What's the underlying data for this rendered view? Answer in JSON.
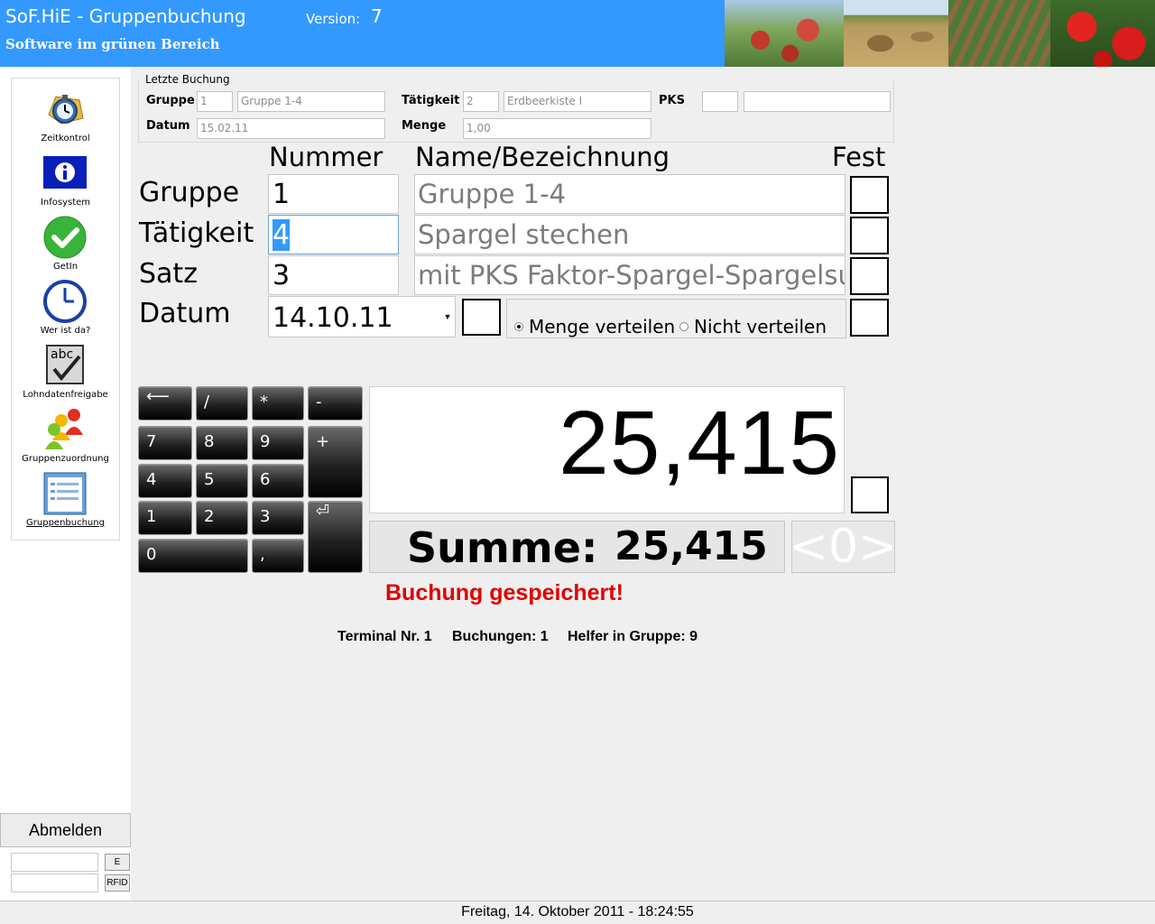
{
  "header": {
    "title": "SoF.HiE - Gruppenbuchung",
    "version_label": "Version:",
    "version_value": "7",
    "subtitle": "Software im grünen Bereich"
  },
  "sidebar": {
    "items": [
      {
        "label": "Zeitkontrol",
        "icon": "stopwatch-icon"
      },
      {
        "label": "Infosystem",
        "icon": "info-icon"
      },
      {
        "label": "GetIn",
        "icon": "checkmark-icon"
      },
      {
        "label": "Wer ist da?",
        "icon": "clock-icon"
      },
      {
        "label": "Lohndatenfreigabe",
        "icon": "abc-check-icon"
      },
      {
        "label": "Gruppenzuordnung",
        "icon": "people-group-icon"
      },
      {
        "label": "Gruppenbuchung",
        "icon": "list-window-icon",
        "active": true
      }
    ]
  },
  "login": {
    "logout_label": "Abmelden",
    "e_button": "E",
    "rfid_button": "RFID"
  },
  "last_booking": {
    "legend": "Letzte Buchung",
    "gruppe_label": "Gruppe",
    "gruppe_nr": "1",
    "gruppe_name": "Gruppe 1-4",
    "taetigkeit_label": "Tätigkeit",
    "taetigkeit_nr": "2",
    "taetigkeit_name": "Erdbeerkiste I",
    "pks_label": "PKS",
    "pks_nr": "",
    "pks_name": "",
    "datum_label": "Datum",
    "datum_value": "15.02.11",
    "menge_label": "Menge",
    "menge_value": "1,00"
  },
  "form": {
    "col_nummer": "Nummer",
    "col_name": "Name/Bezeichnung",
    "col_fest": "Fest",
    "rows": [
      {
        "label": "Gruppe",
        "nummer": "1",
        "name": "Gruppe 1-4"
      },
      {
        "label": "Tätigkeit",
        "nummer": "4",
        "name": "Spargel stechen"
      },
      {
        "label": "Satz",
        "nummer": "3",
        "name": "mit PKS Faktor-Spargel-Spargelsuppe"
      }
    ],
    "datum_label": "Datum",
    "datum_value": "14.10.11",
    "radio_menge": "Menge verteilen",
    "radio_nicht": "Nicht verteilen",
    "radio_selected": "Menge verteilen"
  },
  "keypad": {
    "backspace": "⟵",
    "divide": "/",
    "multiply": "*",
    "minus": "-",
    "plus": "+",
    "enter": "⏎",
    "k7": "7",
    "k8": "8",
    "k9": "9",
    "k4": "4",
    "k5": "5",
    "k6": "6",
    "k1": "1",
    "k2": "2",
    "k3": "3",
    "k0": "0",
    "comma": ","
  },
  "display": {
    "value": "25,415",
    "sum_label": "Summe:",
    "sum_value": "25,415",
    "zero_button": "<0>"
  },
  "status": {
    "message": "Buchung gespeichert!",
    "terminal": "Terminal Nr. 1",
    "buchungen": "Buchungen: 1",
    "helfer": "Helfer in Gruppe: 9"
  },
  "statusbar": {
    "datetime": "Freitag, 14. Oktober 2011 - 18:24:55"
  },
  "colors": {
    "header_blue": "#3399ff",
    "status_red": "#e10000",
    "selection_blue": "#3399ff"
  }
}
